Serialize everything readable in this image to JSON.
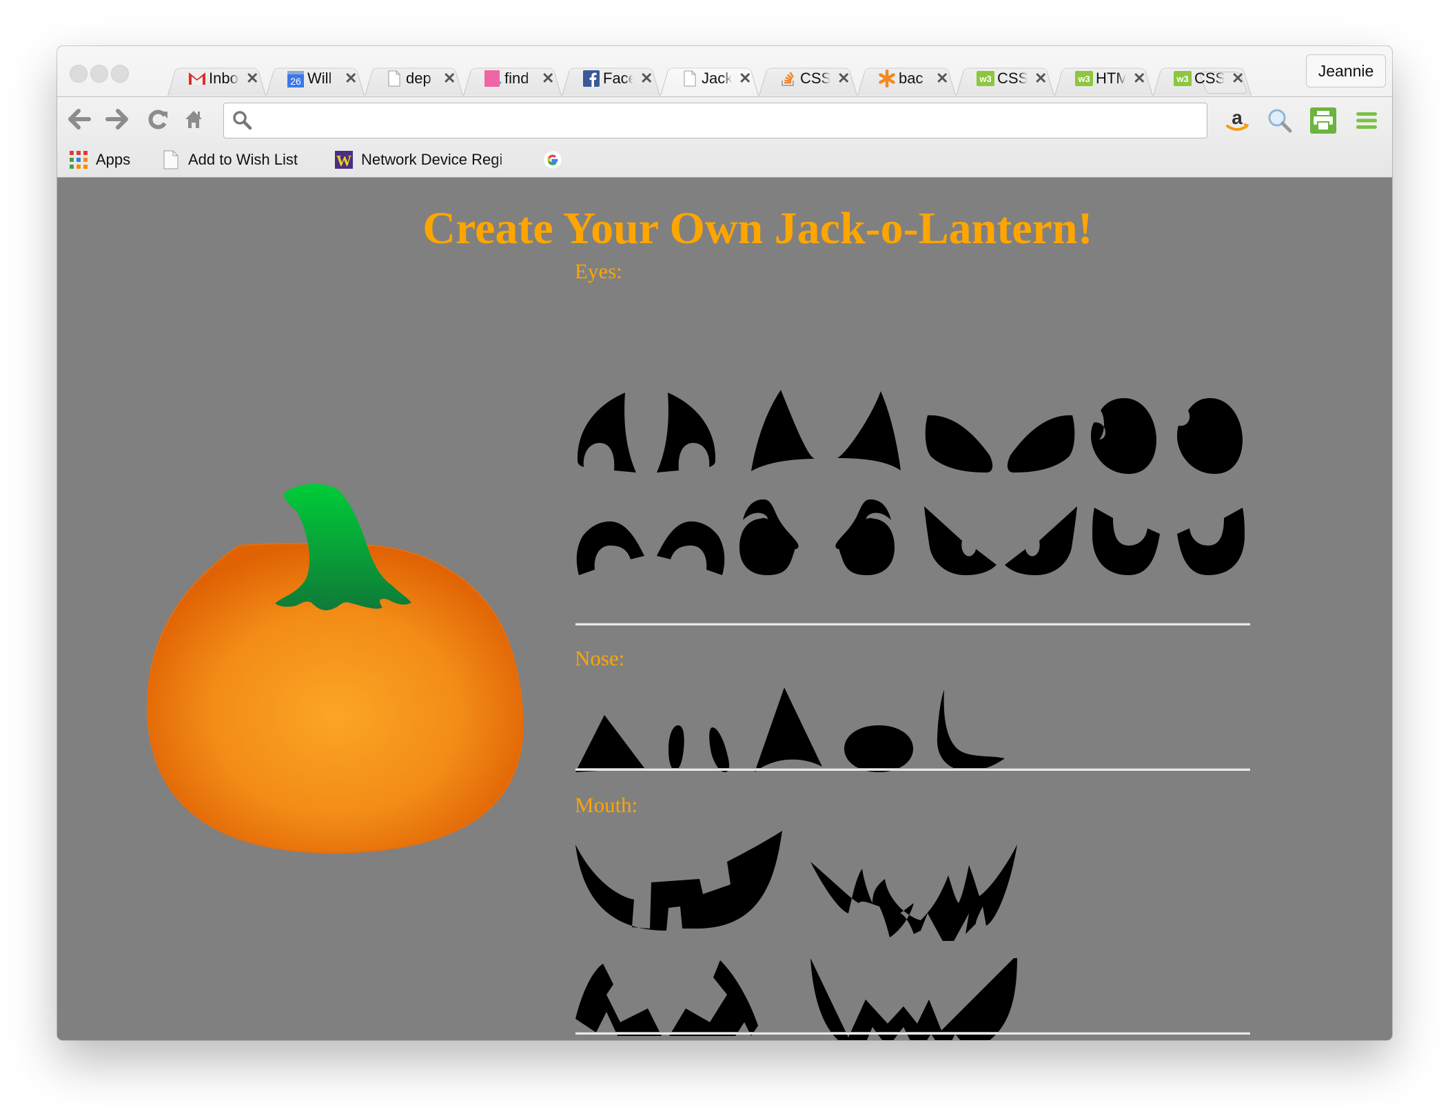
{
  "browser": {
    "tabs": [
      {
        "title": "Inbox",
        "favicon": "gmail-icon",
        "active": false
      },
      {
        "title": "Will",
        "favicon": "calendar-icon",
        "calendar_day": "26",
        "active": false
      },
      {
        "title": "dep",
        "favicon": "page-icon",
        "active": false
      },
      {
        "title": "find",
        "favicon": "pink-site-icon",
        "active": false
      },
      {
        "title": "Face",
        "favicon": "facebook-icon",
        "active": false
      },
      {
        "title": "Jack",
        "favicon": "page-icon",
        "active": true
      },
      {
        "title": "CSS",
        "favicon": "stackoverflow-icon",
        "active": false
      },
      {
        "title": "bac",
        "favicon": "asterisk-icon",
        "active": false
      },
      {
        "title": "CSS",
        "favicon": "w3schools-icon",
        "active": false
      },
      {
        "title": "HTM",
        "favicon": "w3schools-icon",
        "active": false
      },
      {
        "title": "CSS",
        "favicon": "w3schools-icon",
        "active": false
      }
    ],
    "close_glyph": "✕",
    "profile_name": "Jeannie",
    "address_bar": {
      "value": "",
      "placeholder": ""
    },
    "bookmarks": [
      {
        "label": "Apps",
        "icon": "apps-grid-icon"
      },
      {
        "label": "Add to Wish List",
        "icon": "page-icon"
      },
      {
        "label": "Network Device Regi",
        "icon": "uw-w-icon"
      },
      {
        "label": "",
        "icon": "google-icon"
      }
    ],
    "extensions": [
      "amazon-icon",
      "magnifier-icon",
      "print-icon",
      "menu-icon"
    ]
  },
  "page": {
    "title": "Create Your Own Jack-o-Lantern!",
    "background_color": "#808080",
    "accent_color": "#ffa500",
    "sections": {
      "eyes": {
        "label": "Eyes:",
        "count": 16
      },
      "nose": {
        "label": "Nose:",
        "count": 5
      },
      "mouth": {
        "label": "Mouth:",
        "count": 4
      }
    }
  }
}
